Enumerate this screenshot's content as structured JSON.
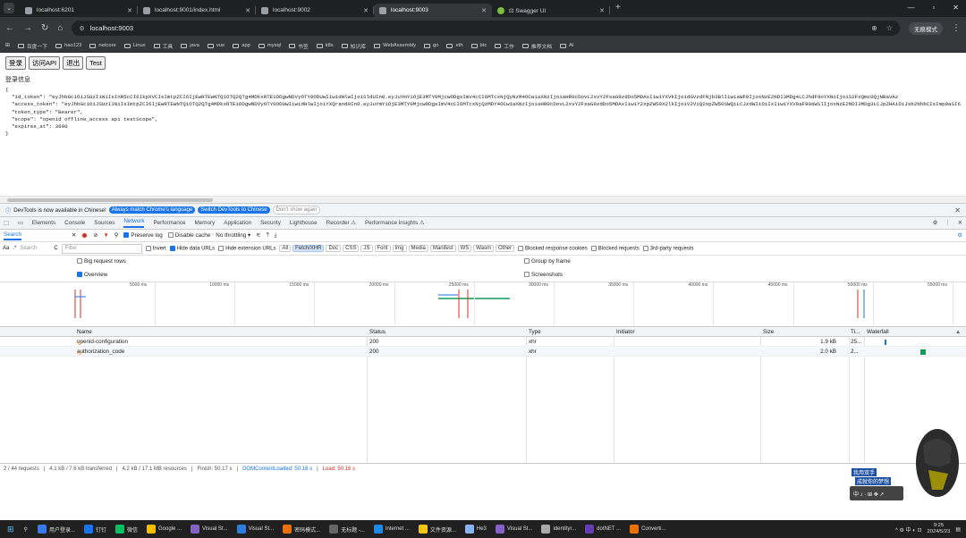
{
  "tabs": [
    {
      "title": "localhost:6201",
      "active": false
    },
    {
      "title": "localhost:9001/index.html",
      "active": false
    },
    {
      "title": "localhost:9002",
      "active": false
    },
    {
      "title": "localhost:9003",
      "active": true
    },
    {
      "title": "⊡ Swagger UI",
      "active": false
    }
  ],
  "toolbar": {
    "url": "localhost:9003",
    "profile_label": "无痕模式"
  },
  "bookmarks": [
    "百度一下",
    "hao123",
    "netcore",
    "Linux",
    "工具",
    "java",
    "vue",
    "app",
    "mysql",
    "书签",
    "k8s",
    "知识库",
    "WebAssembly",
    "go",
    "eth",
    "btc",
    "工作",
    "推荐文档",
    "AI"
  ],
  "page": {
    "buttons": [
      "登录",
      "访问API",
      "退出",
      "Test"
    ],
    "heading": "登录信息",
    "json_lines": [
      "{",
      "  \"id_token\": \"eyJhbGciOiJSUzI1NiIsInR5cCI6IkpXVCIsImtpZCI6IjEwRTEwNTQ1OTQ2QTg4MDkxRTE1ODgwNDVyOTY0ODUwIiwidHlwIjoiSldUIn0.eyJuYmYiOjE3MTY0MjcwODgsImV4cCI6MTcxNjQyNzM4OCwiaXNzIjoiaHR0cDovL2xvY2FsaG9zdDo5MDAxIiwiYXVkIjoidGVzdFNjb3BlIiwiaWF0IjoxNzE2NDI3MDg4LCJhdF9oYXNoIjoiS2FxQmc0QjNBaVAz",
      "  \"access_token\": \"eyJhbGciOiJSUzI1NiIsImtpZCI6IjEwRTEwNTQ1OTQ2QTg4MDkxRTE1ODgwNDVyOTY0ODUwIiwidHlwIjoiYXQrand0In0.eyJuYmYiOjE3MTY0MjcwODgsImV4cCI6MTcxNjQzMDY4OCwiaXNzIjoiaHR0cDovL2xvY2FsaG9zdDo5MDAxIiwiY2xpZW50X2lkIjoiV2ViQ2xpZW50SWQiLCJzdWIiOiIxIiwiYXV0aF90aW1lIjoxNzE2NDI3MDg3LCJpZHAiOiJsb2NhbCIsImp0aSI6",
      "  \"token_type\": \"Bearer\",",
      "  \"scope\": \"openid offline_access api testScope\",",
      "  \"expires_at\": 3600",
      "}"
    ]
  },
  "devtools": {
    "banner": {
      "text": "DevTools is now available in Chinese!",
      "btn_match": "Always match Chrome's language",
      "btn_switch": "Switch DevTools to Chinese",
      "btn_dismiss": "Don't show again"
    },
    "tabs": [
      "Elements",
      "Console",
      "Sources",
      "Network",
      "Performance",
      "Memory",
      "Application",
      "Security",
      "Lighthouse",
      "Recorder ⚠",
      "Performance insights ⚠"
    ],
    "selected_tab": "Network",
    "search_label": "Search",
    "preserve_log": "Preserve log",
    "disable_cache": "Disable cache",
    "throttling": "No throttling",
    "search_placeholder": "Search",
    "filter_placeholder": "Filter",
    "invert": "Invert",
    "hide_data_urls": "Hide data URLs",
    "hide_ext_urls": "Hide extension URLs",
    "type_filters": [
      "All",
      "Fetch/XHR",
      "Doc",
      "CSS",
      "JS",
      "Font",
      "Img",
      "Media",
      "Manifest",
      "WS",
      "Wasm",
      "Other"
    ],
    "selected_type": "Fetch/XHR",
    "blocked_cookies": "Blocked response cookies",
    "blocked_requests": "Blocked requests",
    "third_party": "3rd-party requests",
    "big_rows": "Big request rows",
    "group_by_frame": "Group by frame",
    "overview": "Overview",
    "screenshots": "Screenshots",
    "timeline_ticks": [
      "5000 ms",
      "10000 ms",
      "15000 ms",
      "20000 ms",
      "25000 ms",
      "30000 ms",
      "35000 ms",
      "40000 ms",
      "45000 ms",
      "50000 ms",
      "55000 ms"
    ],
    "columns": [
      "Name",
      "Status",
      "Type",
      "Initiator",
      "Size",
      "Ti...",
      "Waterfall"
    ],
    "rows": [
      {
        "name": "openid-configuration",
        "status": "200",
        "type": "xhr",
        "initiator": "",
        "size": "1.9 kB",
        "time": "25...",
        "wf_start": 0.2,
        "color": "#1a73e8"
      },
      {
        "name": "authorization_code",
        "status": "200",
        "type": "xhr",
        "initiator": "",
        "size": "2.0 kB",
        "time": "2...",
        "wf_start": 0.6,
        "color": "#0f9d58"
      }
    ],
    "status": {
      "requests": "2 / 44 requests",
      "transferred": "4.1 kB / 7.6 kB transferred",
      "resources": "4.2 kB / 17.1 MB resources",
      "finish": "Finish: 50.17 s",
      "dcl": "DOMContentLoaded: 50.16 s",
      "load": "Load: 50.16 s"
    }
  },
  "taskbar": {
    "items": [
      "用户登录...",
      "钉钉",
      "微信",
      "Google ...",
      "Visual St...",
      "Visual St...",
      "密码模式...",
      "无标题 -...",
      "Internet ...",
      "文件资源...",
      "He3",
      "Visual St...",
      "identityr...",
      "dotNET ...",
      "Converti..."
    ],
    "clock_time": "9:25",
    "clock_date": "2024/5/23"
  },
  "overlay": {
    "line1": "我用双手",
    "line2": "成就你的梦想",
    "sig": "zhaoguomin"
  }
}
